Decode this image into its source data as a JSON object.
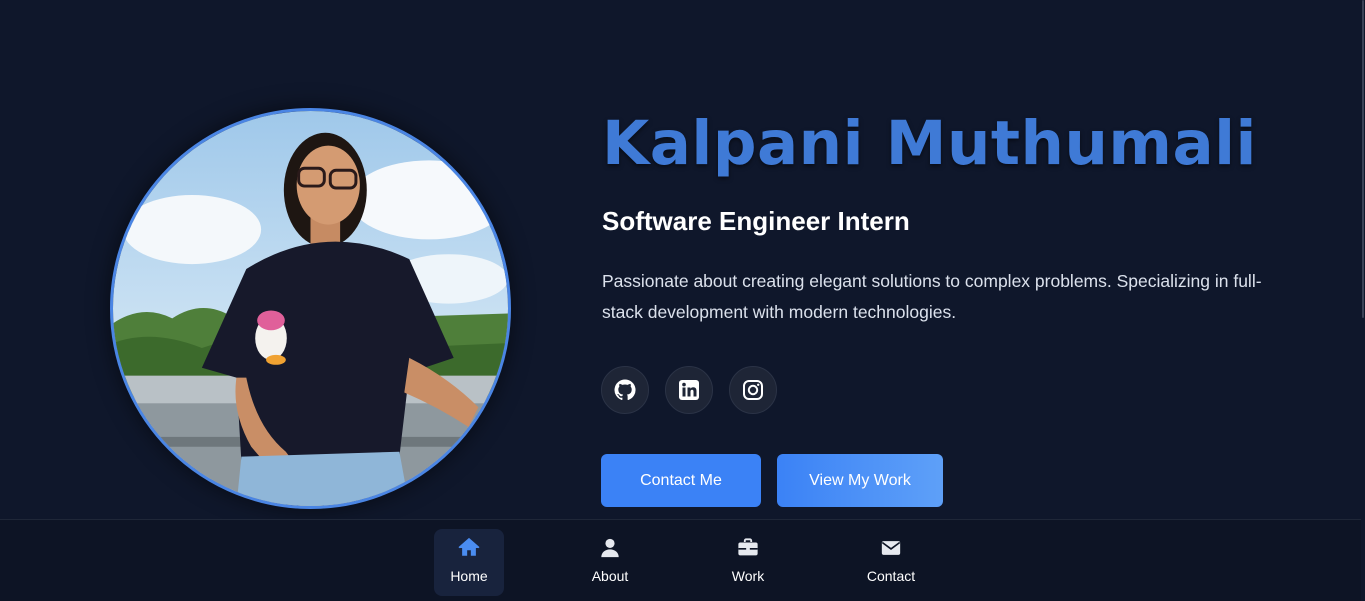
{
  "hero": {
    "name": "Kalpani Muthumali",
    "role": "Software Engineer Intern",
    "bio": "Passionate about creating elegant solutions to complex problems. Specializing in full-stack development with modern technologies."
  },
  "social": [
    {
      "icon": "github-icon"
    },
    {
      "icon": "linkedin-icon"
    },
    {
      "icon": "instagram-icon"
    }
  ],
  "actions": {
    "contact_label": "Contact Me",
    "work_label": "View My Work"
  },
  "nav": {
    "active": "Home",
    "items": [
      {
        "label": "Home",
        "icon": "home-icon"
      },
      {
        "label": "About",
        "icon": "user-icon"
      },
      {
        "label": "Work",
        "icon": "briefcase-icon"
      },
      {
        "label": "Contact",
        "icon": "envelope-icon"
      }
    ]
  },
  "colors": {
    "background": "#0f172b",
    "accent": "#3b82f6",
    "name_blue": "#3f7ad6",
    "nav_active": "#4a8cf0"
  }
}
